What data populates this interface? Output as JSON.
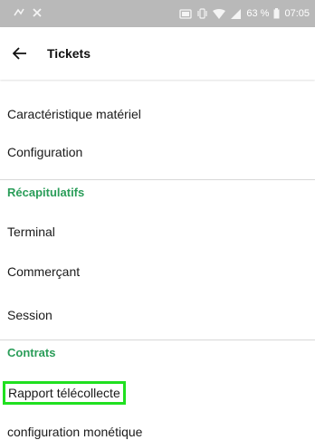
{
  "status_bar": {
    "battery": "63 %",
    "time": "07:05"
  },
  "header": {
    "title": "Tickets"
  },
  "list": {
    "items": [
      {
        "label": "Caractéristique matériel"
      },
      {
        "label": "Configuration"
      }
    ],
    "sections": [
      {
        "title": "Récapitulatifs",
        "items": [
          "Terminal",
          "Commerçant",
          "Session"
        ]
      },
      {
        "title": "Contrats",
        "items": [
          "Rapport télécollecte",
          "configuration monétique"
        ]
      }
    ]
  },
  "colors": {
    "section_header": "#2a9d59",
    "highlight": "#20e020",
    "status_bar": "#b9b9b9"
  }
}
